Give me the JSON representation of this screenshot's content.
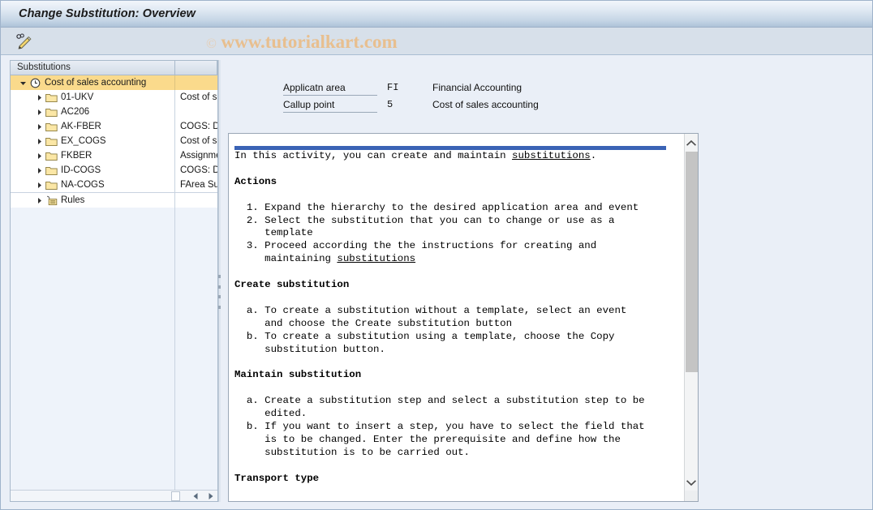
{
  "window": {
    "title": "Change Substitution: Overview"
  },
  "toolbar": {
    "edit_icon": "pencil-edit-icon",
    "edit_tooltip": "Change"
  },
  "watermark": {
    "copyright": "©",
    "text": "www.tutorialkart.com"
  },
  "tree": {
    "header": {
      "column1": "Substitutions",
      "column2": ""
    },
    "rows": [
      {
        "label": "Cost of sales accounting",
        "desc": "",
        "icon": "clock-icon",
        "indent": 0,
        "expanded": true,
        "selected": true
      },
      {
        "label": "01-UKV",
        "desc": "Cost of sa",
        "icon": "folder-icon",
        "indent": 1,
        "expanded": false,
        "selected": false
      },
      {
        "label": "AC206",
        "desc": "",
        "icon": "folder-icon",
        "indent": 1,
        "expanded": false,
        "selected": false
      },
      {
        "label": "AK-FBER",
        "desc": "COGS: De",
        "icon": "folder-icon",
        "indent": 1,
        "expanded": false,
        "selected": false
      },
      {
        "label": "EX_COGS",
        "desc": "Cost of sa",
        "icon": "folder-icon",
        "indent": 1,
        "expanded": false,
        "selected": false
      },
      {
        "label": "FKBER",
        "desc": "Assignme",
        "icon": "folder-icon",
        "indent": 1,
        "expanded": false,
        "selected": false
      },
      {
        "label": "ID-COGS",
        "desc": "COGS: De",
        "icon": "folder-icon",
        "indent": 1,
        "expanded": false,
        "selected": false
      },
      {
        "label": "NA-COGS",
        "desc": "FArea Su",
        "icon": "folder-icon",
        "indent": 1,
        "expanded": false,
        "selected": false
      },
      {
        "label": "Rules",
        "desc": "",
        "icon": "rules-icon",
        "indent": 1,
        "expanded": false,
        "selected": false
      }
    ],
    "hscroll": {
      "left_arrow": "triangle-left-icon",
      "right_arrow": "triangle-right-icon"
    },
    "splitter": "splitter-grip-icon"
  },
  "form": {
    "rows": [
      {
        "label": "Applicatn area",
        "value": "FI",
        "description": "Financial Accounting"
      },
      {
        "label": "Callup point",
        "value": "5",
        "description": "Cost of sales accounting"
      }
    ]
  },
  "documentation": {
    "accent_color": "#3a63b5",
    "body": "In this activity, you can create and maintain substitutions.\n\nActions\n\n  1. Expand the hierarchy to the desired application area and event\n  2. Select the substitution that you can to change or use as a\n     template\n  3. Proceed according the the instructions for creating and\n     maintaining substitutions\n\nCreate substitution\n\n  a. To create a substitution without a template, select an event\n     and choose the Create substitution button\n  b. To create a substitution using a template, choose the Copy\n     substitution button.\n\nMaintain substitution\n\n  a. Create a substitution step and select a substitution step to be\n     edited.\n  b. If you want to insert a step, you have to select the field that\n     is to be changed. Enter the prerequisite and define how the\n     substitution is to be carried out.\n\nTransport type",
    "headings": [
      "Actions",
      "Create substitution",
      "Maintain substitution",
      "Transport type"
    ],
    "linked_term": "substitutions",
    "scrollbar": {
      "up_arrow": "chevron-up-icon",
      "down_arrow": "chevron-down-icon"
    }
  },
  "colors": {
    "titlebar_accent": "#adc2d8",
    "selection": "#fada8c",
    "doc_accent": "#3a63b5",
    "watermark": "#e8bf8f",
    "page_bg": "#eaeff7"
  }
}
